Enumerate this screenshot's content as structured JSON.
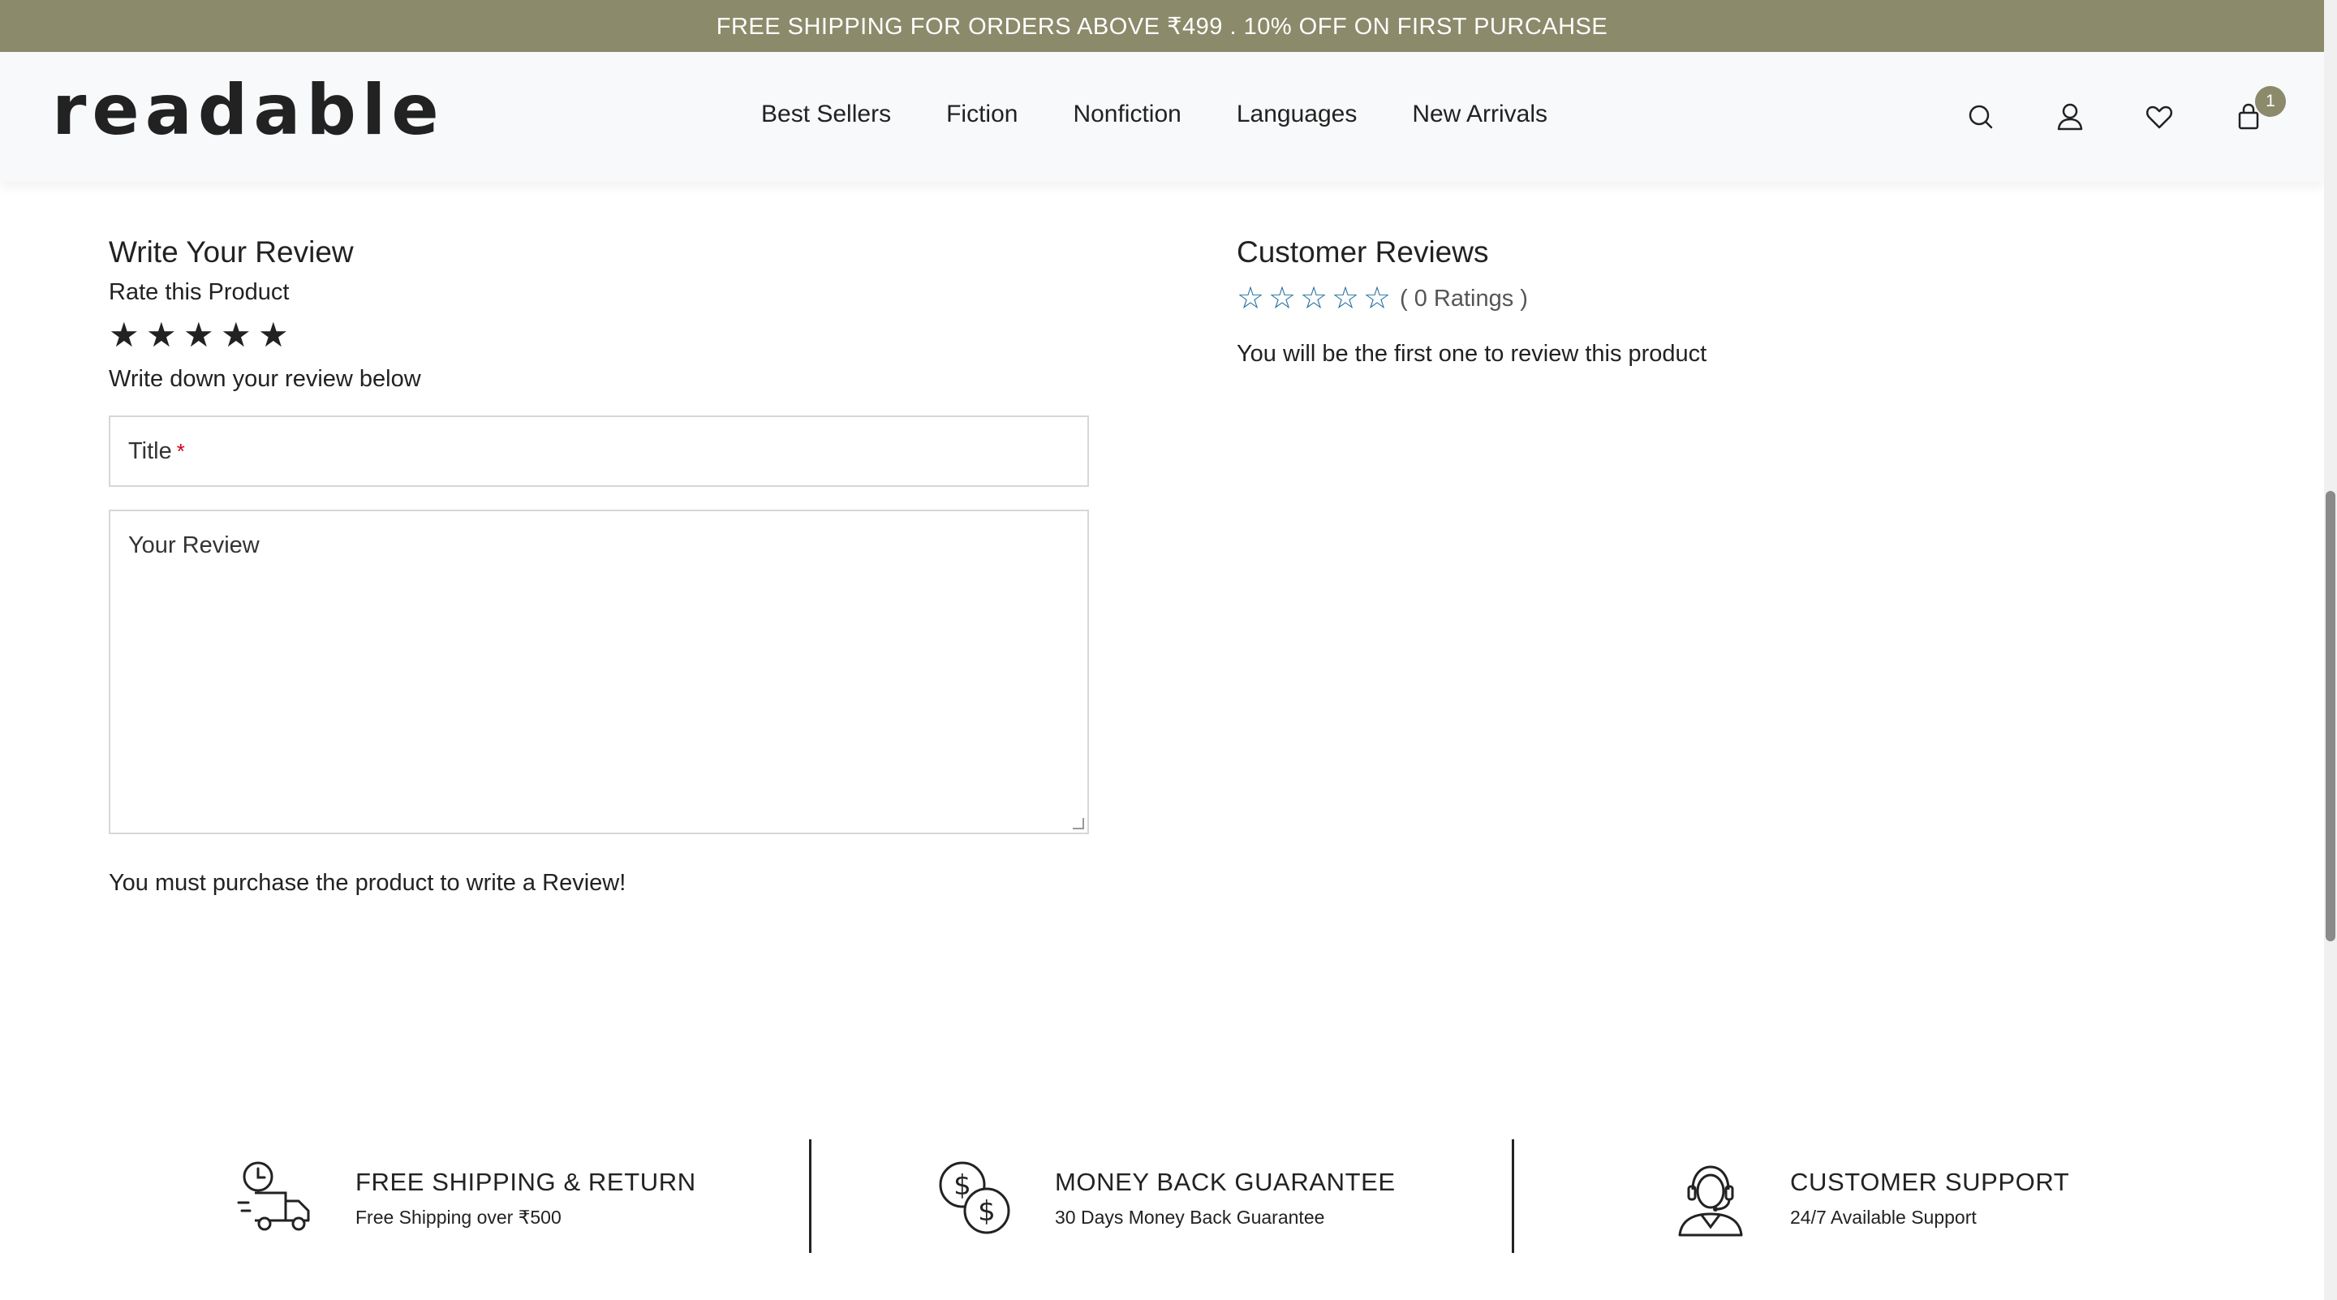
{
  "announcement": "FREE SHIPPING FOR ORDERS ABOVE ₹499 . 10% OFF ON FIRST PURCAHSE",
  "header": {
    "logo": "readable",
    "nav": [
      "Best Sellers",
      "Fiction",
      "Nonfiction",
      "Languages",
      "New Arrivals"
    ],
    "icons": [
      "search-icon",
      "account-icon",
      "wishlist-heart-icon",
      "cart-bag-icon"
    ],
    "cart_count": "1"
  },
  "write_review": {
    "title": "Write Your Review",
    "rate_label": "Rate this Product",
    "star_count": 5,
    "write_label": "Write down your review below",
    "title_placeholder": "Title",
    "required_marker": "*",
    "review_placeholder": "Your Review",
    "purchase_note": "You must purchase the product to write a Review!"
  },
  "customer_reviews": {
    "title": "Customer Reviews",
    "rating": 0,
    "ratings_label": "( 0 Ratings )",
    "empty_note": "You will be the first one to review this product"
  },
  "features": [
    {
      "icon": "delivery-truck-clock-icon",
      "title": "FREE SHIPPING & RETURN",
      "subtitle": "Free Shipping over ₹500"
    },
    {
      "icon": "money-coins-icon",
      "title": "MONEY BACK GUARANTEE",
      "subtitle": "30 Days Money Back Guarantee"
    },
    {
      "icon": "support-headset-icon",
      "title": "CUSTOMER SUPPORT",
      "subtitle": "24/7 Available Support"
    }
  ],
  "colors": {
    "brand_olive": "#8b8a6b",
    "star_outline_blue": "#1f6e9c",
    "required_red": "#d0021b"
  }
}
